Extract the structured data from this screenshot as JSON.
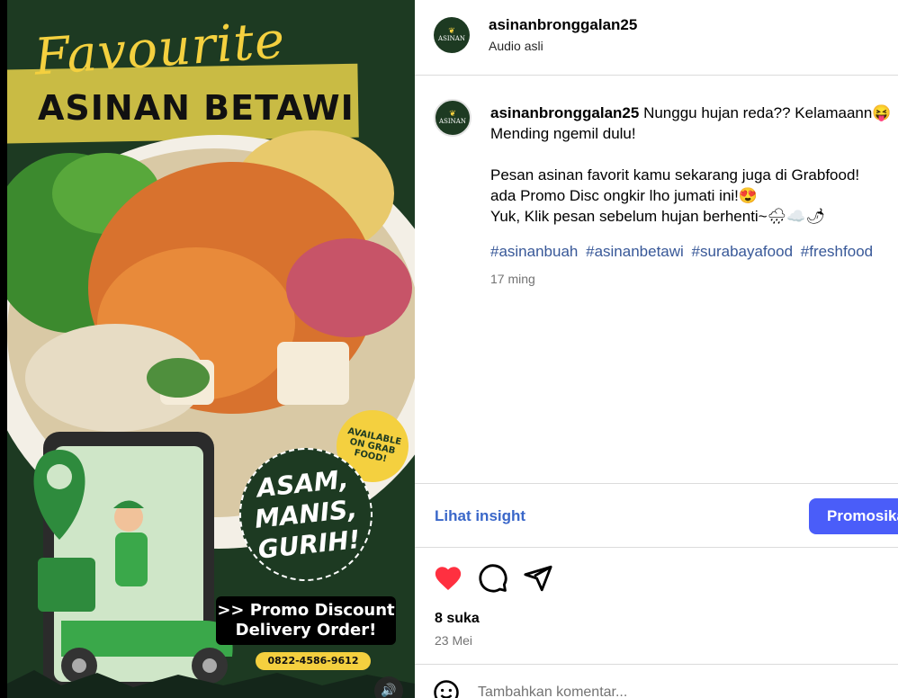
{
  "media": {
    "banner_script": "Favourite",
    "banner_title": "ASINAN BETAWI",
    "grab_badge": "AVAILABLE ON GRAB FOOD!",
    "taste_badge": "ASAM,\nMANIS,\nGURIH!",
    "promo_box": ">> Promo Discount\nDelivery Order!",
    "phone": "0822-4586-9612",
    "volume_icon": "speaker-icon"
  },
  "header": {
    "username": "asinanbronggalan25",
    "subtitle": "Audio asli",
    "avatar_text": "ASINAN"
  },
  "caption": {
    "username": "asinanbronggalan25",
    "line1": "Nunggu hujan reda?? Kelamaann😝",
    "line2": "Mending ngemil dulu!",
    "line3": "Pesan asinan favorit kamu sekarang juga di Grabfood!",
    "line4": "ada Promo Disc ongkir lho jumati ini!😍",
    "line5": "Yuk, Klik pesan sebelum hujan berhenti~🌧☁️🌶",
    "hashtags": [
      "#asinanbuah",
      "#asinanbetawi",
      "#surabayafood",
      "#freshfood"
    ],
    "age": "17 ming"
  },
  "insight": {
    "link": "Lihat insight",
    "promote_button": "Promosikan"
  },
  "actions": {
    "like_icon": "heart-filled-icon",
    "comment_icon": "comment-icon",
    "share_icon": "paper-plane-icon",
    "like_color": "#ff3040",
    "likes": "8 suka",
    "date": "23 Mei"
  },
  "comment": {
    "placeholder": "Tambahkan komentar..."
  }
}
